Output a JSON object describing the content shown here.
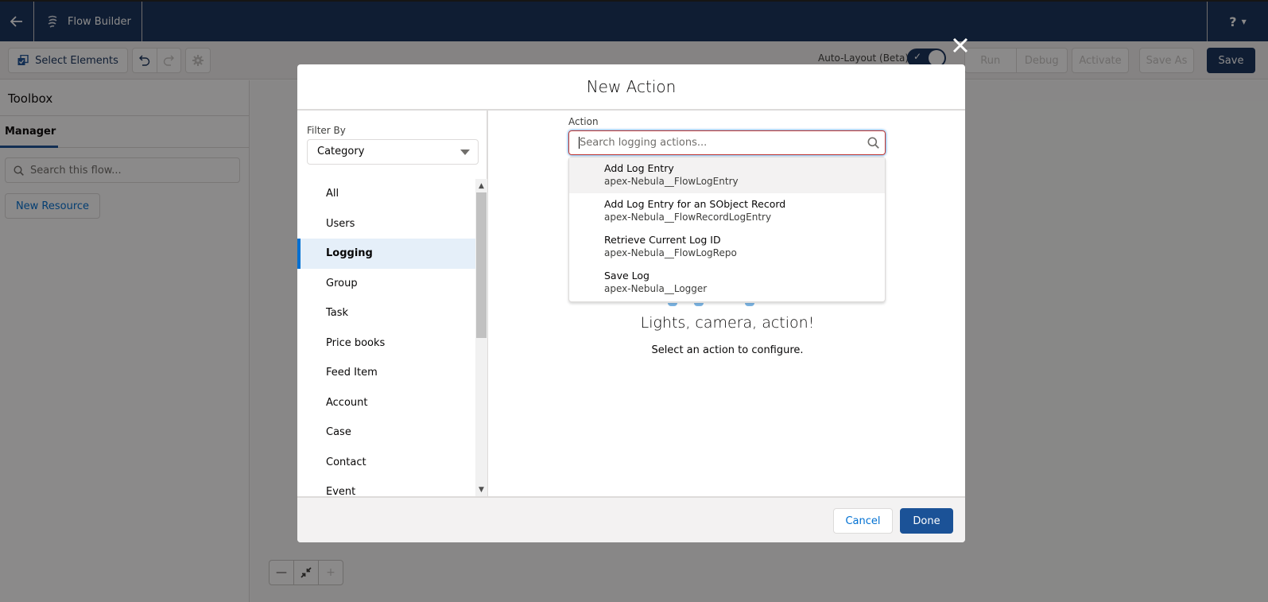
{
  "header": {
    "app_title": "Flow Builder",
    "help_label": "?"
  },
  "toolbar": {
    "select_elements_label": "Select Elements",
    "auto_layout_label": "Auto-Layout (Beta)",
    "auto_layout_on": true,
    "run_label": "Run",
    "debug_label": "Debug",
    "activate_label": "Activate",
    "save_as_label": "Save As",
    "save_label": "Save"
  },
  "toolbox": {
    "title": "Toolbox",
    "tab_label": "Manager",
    "search_placeholder": "Search this flow...",
    "new_resource_label": "New Resource"
  },
  "modal": {
    "title": "New Action",
    "filter_label": "Filter By",
    "filter_value": "Category",
    "categories": [
      {
        "label": "All"
      },
      {
        "label": "Users"
      },
      {
        "label": "Logging",
        "selected": true
      },
      {
        "label": "Group"
      },
      {
        "label": "Task"
      },
      {
        "label": "Price books"
      },
      {
        "label": "Feed Item"
      },
      {
        "label": "Account"
      },
      {
        "label": "Case"
      },
      {
        "label": "Contact"
      },
      {
        "label": "Event"
      }
    ],
    "action_label": "Action",
    "action_search_placeholder": "Search logging actions...",
    "actions": [
      {
        "title": "Add Log Entry",
        "api_name": "apex-Nebula__FlowLogEntry"
      },
      {
        "title": "Add Log Entry for an SObject Record",
        "api_name": "apex-Nebula__FlowRecordLogEntry"
      },
      {
        "title": "Retrieve Current Log ID",
        "api_name": "apex-Nebula__FlowLogRepo"
      },
      {
        "title": "Save Log",
        "api_name": "apex-Nebula__Logger"
      }
    ],
    "empty_title": "Lights, camera, action!",
    "empty_subtitle": "Select an action to configure.",
    "cancel_label": "Cancel",
    "done_label": "Done"
  },
  "colors": {
    "header_bg": "#16325c",
    "brand_blue": "#1b5297",
    "selected_bg": "#e5eff9",
    "error_border": "#c23934"
  }
}
